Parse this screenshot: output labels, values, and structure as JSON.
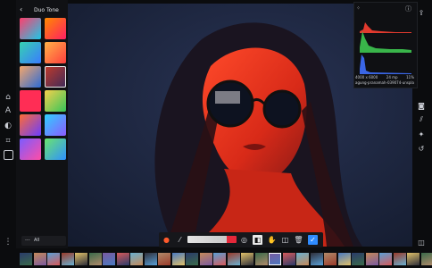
{
  "app": {
    "panel_title": "Duo Tone"
  },
  "presets": {
    "swatches": [
      {
        "c1": "#ff3f6d",
        "c2": "#1cc8e8"
      },
      {
        "c1": "#ff8a00",
        "c2": "#ff1f64"
      },
      {
        "c1": "#36d3b0",
        "c2": "#3a7bff"
      },
      {
        "c1": "#ffb347",
        "c2": "#ff3e3e"
      },
      {
        "c1": "#f5a76b",
        "c2": "#2d6bd6"
      },
      {
        "c1": "#c23a2a",
        "c2": "#3d2a5a"
      },
      {
        "c1": "#ff2d55",
        "c2": "#ff2d55"
      },
      {
        "c1": "#f5d04c",
        "c2": "#35c55a"
      },
      {
        "c1": "#ff6c34",
        "c2": "#6a3dff"
      },
      {
        "c1": "#2ed0ff",
        "c2": "#8c5bff"
      },
      {
        "c1": "#7b5cff",
        "c2": "#ff4da6"
      },
      {
        "c1": "#6be46d",
        "c2": "#2f91ff"
      }
    ],
    "selected_index": 5
  },
  "filter": {
    "value": "All"
  },
  "histogram": {
    "dimensions": "4000 x 6000",
    "iso": "24 mp",
    "zoom": "11%",
    "filename": "agung-pranamah-039074-unspla..."
  },
  "icons": {
    "menu": "vertical-dots",
    "back": "chevron-left",
    "grid": "grid-dots",
    "share": "share-up",
    "info": "info-circle"
  },
  "colors": {
    "accent": "#2f8bff",
    "duotone_dark": "#1e2a46",
    "duotone_light": "#ff3a1f"
  }
}
